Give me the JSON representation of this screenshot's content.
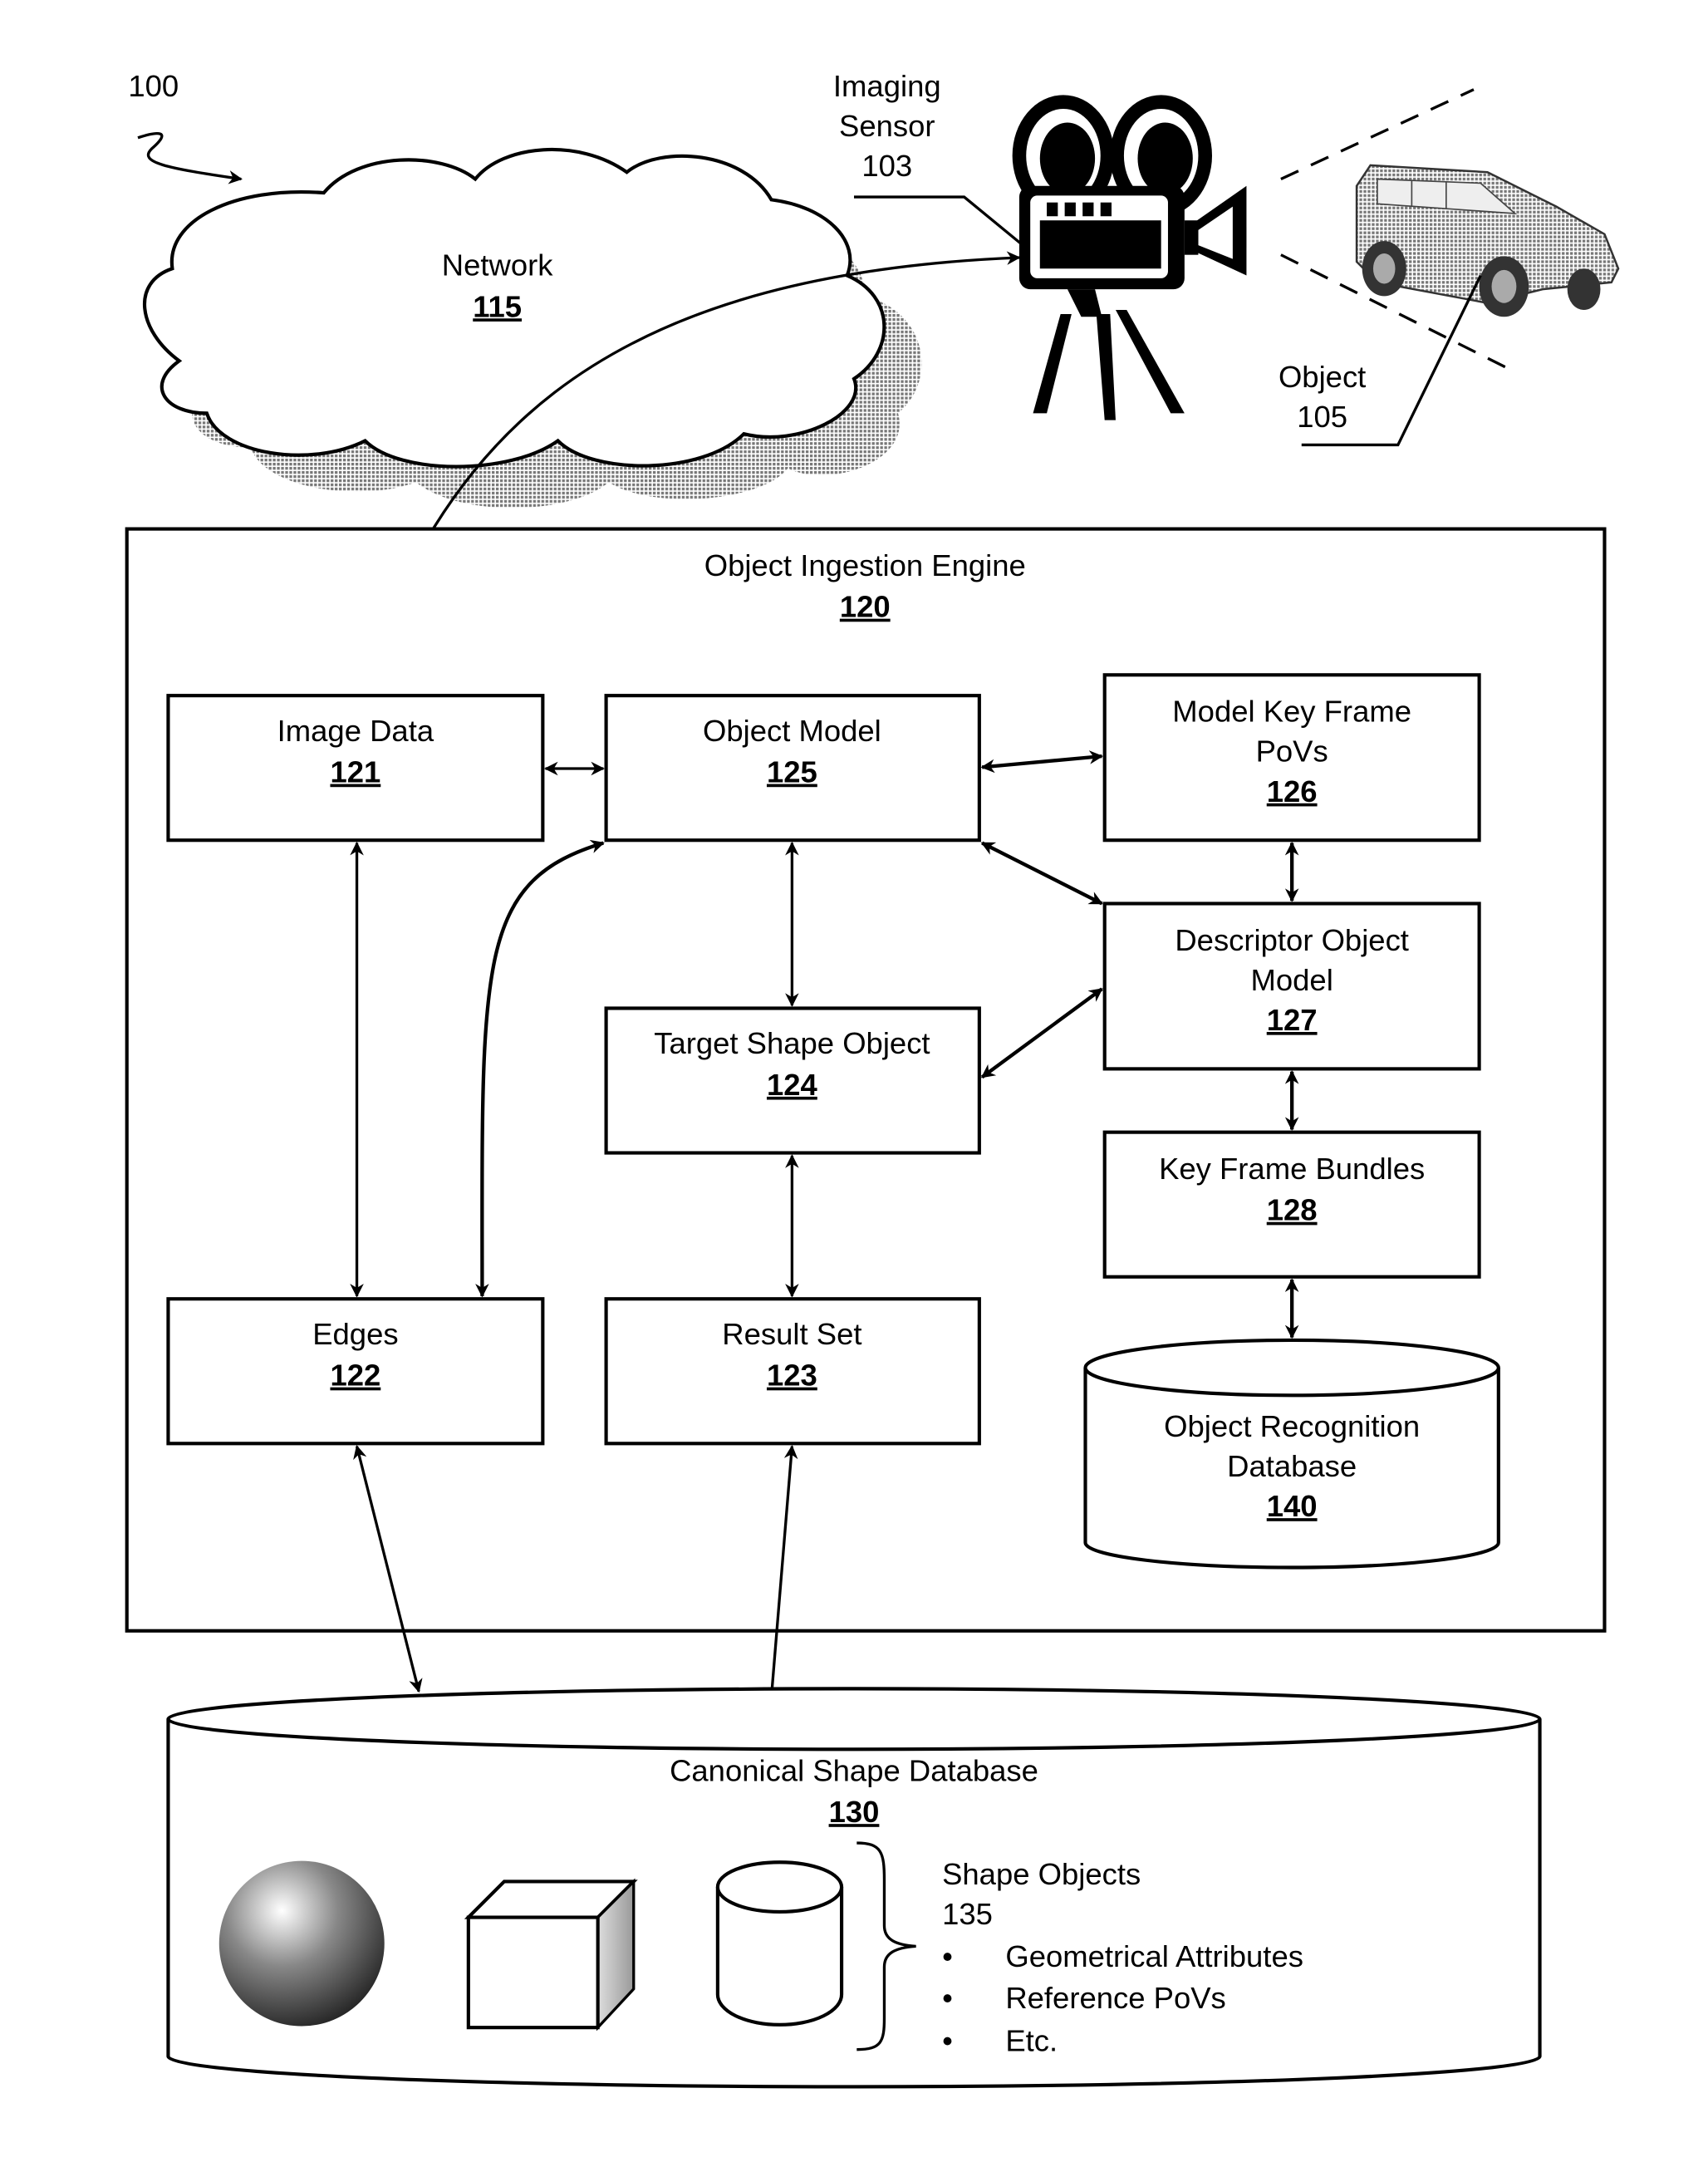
{
  "figure": {
    "ref": "100"
  },
  "network": {
    "label": "Network",
    "num": "115"
  },
  "imaging_sensor": {
    "label_line1": "Imaging",
    "label_line2": "Sensor",
    "num": "103"
  },
  "object": {
    "label": "Object",
    "num": "105"
  },
  "engine": {
    "label": "Object Ingestion Engine",
    "num": "120"
  },
  "boxes": {
    "image_data": {
      "label": "Image Data",
      "num": "121"
    },
    "edges": {
      "label": "Edges",
      "num": "122"
    },
    "result_set": {
      "label": "Result Set",
      "num": "123"
    },
    "target_shape": {
      "label": "Target Shape Object",
      "num": "124"
    },
    "object_model": {
      "label": "Object Model",
      "num": "125"
    },
    "key_frame_povs": {
      "label_line1": "Model Key Frame",
      "label_line2": "PoVs",
      "num": "126"
    },
    "descriptor_model": {
      "label_line1": "Descriptor Object",
      "label_line2": "Model",
      "num": "127"
    },
    "key_frame_bundles": {
      "label": "Key Frame Bundles",
      "num": "128"
    },
    "recognition_db": {
      "label_line1": "Object Recognition",
      "label_line2": "Database",
      "num": "140"
    }
  },
  "canonical_db": {
    "label": "Canonical Shape Database",
    "num": "130",
    "shape_objects_label": "Shape Objects",
    "shape_objects_num": "135",
    "attributes": [
      "Geometrical Attributes",
      "Reference PoVs",
      "Etc."
    ],
    "bullet": "•"
  }
}
